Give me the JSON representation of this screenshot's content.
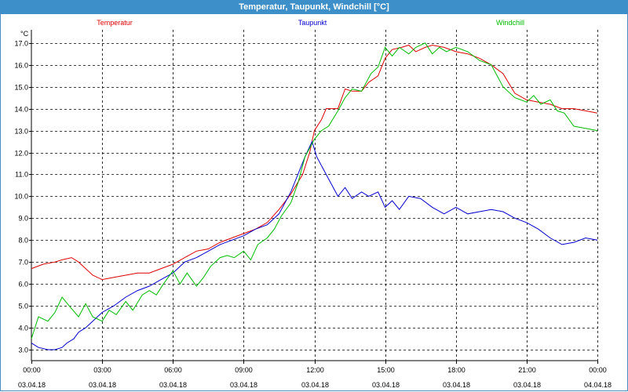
{
  "window": {
    "title": "Temperatur, Taupunkt, Windchill [°C]"
  },
  "chart_data": {
    "type": "line",
    "title": "Temperatur, Taupunkt, Windchill [°C]",
    "ylabel": "°C",
    "xlabel": "",
    "ylim": [
      2.5,
      17.6
    ],
    "xlim": [
      0,
      24
    ],
    "grid": true,
    "legend_placement": "top",
    "yticks": [
      3.0,
      4.0,
      5.0,
      6.0,
      7.0,
      8.0,
      9.0,
      10.0,
      11.0,
      12.0,
      13.0,
      14.0,
      15.0,
      16.0,
      17.0
    ],
    "xticks": [
      {
        "hour": 0,
        "time": "00:00",
        "date": "03.04.18"
      },
      {
        "hour": 3,
        "time": "03:00",
        "date": "03.04.18"
      },
      {
        "hour": 6,
        "time": "06:00",
        "date": "03.04.18"
      },
      {
        "hour": 9,
        "time": "09:00",
        "date": "03.04.18"
      },
      {
        "hour": 12,
        "time": "12:00",
        "date": "03.04.18"
      },
      {
        "hour": 15,
        "time": "15:00",
        "date": "03.04.18"
      },
      {
        "hour": 18,
        "time": "18:00",
        "date": "03.04.18"
      },
      {
        "hour": 21,
        "time": "21:00",
        "date": "03.04.18"
      },
      {
        "hour": 24,
        "time": "00:00",
        "date": "04.04.18"
      }
    ],
    "series": [
      {
        "name": "Temperatur",
        "color": "#dd0000",
        "points": [
          [
            0,
            6.7
          ],
          [
            0.5,
            6.9
          ],
          [
            1,
            7.0
          ],
          [
            1.3,
            7.1
          ],
          [
            1.7,
            7.2
          ],
          [
            2,
            7.0
          ],
          [
            2.3,
            6.7
          ],
          [
            2.6,
            6.4
          ],
          [
            3,
            6.2
          ],
          [
            3.5,
            6.3
          ],
          [
            4,
            6.4
          ],
          [
            4.5,
            6.5
          ],
          [
            5,
            6.5
          ],
          [
            5.5,
            6.7
          ],
          [
            6,
            6.9
          ],
          [
            6.5,
            7.2
          ],
          [
            7,
            7.5
          ],
          [
            7.5,
            7.6
          ],
          [
            8,
            7.9
          ],
          [
            8.5,
            8.1
          ],
          [
            9,
            8.3
          ],
          [
            9.5,
            8.5
          ],
          [
            10,
            8.8
          ],
          [
            10.5,
            9.4
          ],
          [
            11,
            10.1
          ],
          [
            11.5,
            11.0
          ],
          [
            11.8,
            12.0
          ],
          [
            12,
            13.0
          ],
          [
            12.3,
            13.5
          ],
          [
            12.5,
            14.0
          ],
          [
            13,
            14.0
          ],
          [
            13.3,
            14.9
          ],
          [
            13.6,
            14.8
          ],
          [
            14,
            14.8
          ],
          [
            14.3,
            15.2
          ],
          [
            14.7,
            15.5
          ],
          [
            15,
            16.3
          ],
          [
            15.3,
            16.7
          ],
          [
            15.7,
            16.8
          ],
          [
            16,
            16.9
          ],
          [
            16.3,
            16.6
          ],
          [
            16.7,
            16.8
          ],
          [
            17,
            16.9
          ],
          [
            17.5,
            16.8
          ],
          [
            18,
            16.6
          ],
          [
            18.5,
            16.5
          ],
          [
            19,
            16.3
          ],
          [
            19.5,
            16.0
          ],
          [
            20,
            15.6
          ],
          [
            20.5,
            14.7
          ],
          [
            21,
            14.4
          ],
          [
            21.5,
            14.3
          ],
          [
            22,
            14.2
          ],
          [
            22.5,
            14.0
          ],
          [
            23,
            14.0
          ],
          [
            23.5,
            13.9
          ],
          [
            24,
            13.8
          ]
        ]
      },
      {
        "name": "Taupunkt",
        "color": "#0000cc",
        "points": [
          [
            0,
            3.3
          ],
          [
            0.3,
            3.1
          ],
          [
            0.7,
            3.0
          ],
          [
            1,
            3.0
          ],
          [
            1.3,
            3.1
          ],
          [
            1.5,
            3.3
          ],
          [
            1.8,
            3.5
          ],
          [
            2,
            3.8
          ],
          [
            2.3,
            4.0
          ],
          [
            2.6,
            4.3
          ],
          [
            3,
            4.7
          ],
          [
            3.5,
            5.0
          ],
          [
            4,
            5.4
          ],
          [
            4.5,
            5.7
          ],
          [
            5,
            5.9
          ],
          [
            5.5,
            6.2
          ],
          [
            6,
            6.5
          ],
          [
            6.5,
            7.0
          ],
          [
            7,
            7.2
          ],
          [
            7.5,
            7.5
          ],
          [
            8,
            7.8
          ],
          [
            8.5,
            8.0
          ],
          [
            9,
            8.2
          ],
          [
            9.5,
            8.5
          ],
          [
            10,
            8.7
          ],
          [
            10.5,
            9.2
          ],
          [
            11,
            10.2
          ],
          [
            11.3,
            11.0
          ],
          [
            11.6,
            11.8
          ],
          [
            11.9,
            12.5
          ],
          [
            12.1,
            11.8
          ],
          [
            12.4,
            11.2
          ],
          [
            12.7,
            10.6
          ],
          [
            13,
            10.0
          ],
          [
            13.3,
            10.4
          ],
          [
            13.6,
            9.9
          ],
          [
            14,
            10.2
          ],
          [
            14.3,
            10.0
          ],
          [
            14.7,
            10.2
          ],
          [
            15,
            9.5
          ],
          [
            15.3,
            9.8
          ],
          [
            15.6,
            9.4
          ],
          [
            16,
            10.0
          ],
          [
            16.5,
            9.9
          ],
          [
            17,
            9.5
          ],
          [
            17.5,
            9.2
          ],
          [
            18,
            9.5
          ],
          [
            18.5,
            9.2
          ],
          [
            19,
            9.3
          ],
          [
            19.5,
            9.4
          ],
          [
            20,
            9.3
          ],
          [
            20.5,
            9.0
          ],
          [
            21,
            8.8
          ],
          [
            21.5,
            8.5
          ],
          [
            22,
            8.1
          ],
          [
            22.5,
            7.8
          ],
          [
            23,
            7.9
          ],
          [
            23.5,
            8.1
          ],
          [
            24,
            8.0
          ]
        ]
      },
      {
        "name": "Windchill",
        "color": "#00bb00",
        "points": [
          [
            0,
            3.5
          ],
          [
            0.3,
            4.5
          ],
          [
            0.7,
            4.3
          ],
          [
            1,
            4.7
          ],
          [
            1.3,
            5.4
          ],
          [
            1.6,
            5.0
          ],
          [
            2,
            4.5
          ],
          [
            2.3,
            5.1
          ],
          [
            2.6,
            4.5
          ],
          [
            3,
            4.3
          ],
          [
            3.3,
            4.8
          ],
          [
            3.6,
            4.6
          ],
          [
            4,
            5.2
          ],
          [
            4.3,
            4.8
          ],
          [
            4.7,
            5.5
          ],
          [
            5,
            5.7
          ],
          [
            5.3,
            5.5
          ],
          [
            5.6,
            6.0
          ],
          [
            6,
            6.6
          ],
          [
            6.3,
            6.0
          ],
          [
            6.6,
            6.5
          ],
          [
            7,
            5.9
          ],
          [
            7.3,
            6.3
          ],
          [
            7.6,
            6.8
          ],
          [
            8,
            7.2
          ],
          [
            8.3,
            7.3
          ],
          [
            8.6,
            7.2
          ],
          [
            9,
            7.5
          ],
          [
            9.3,
            7.1
          ],
          [
            9.6,
            7.8
          ],
          [
            10,
            8.1
          ],
          [
            10.3,
            8.5
          ],
          [
            10.6,
            9.1
          ],
          [
            11,
            9.7
          ],
          [
            11.3,
            10.6
          ],
          [
            11.6,
            11.8
          ],
          [
            12,
            12.6
          ],
          [
            12.3,
            13.0
          ],
          [
            12.6,
            13.2
          ],
          [
            13,
            13.9
          ],
          [
            13.3,
            14.5
          ],
          [
            13.6,
            14.9
          ],
          [
            14,
            14.8
          ],
          [
            14.4,
            15.6
          ],
          [
            14.7,
            15.9
          ],
          [
            15,
            16.8
          ],
          [
            15.3,
            16.4
          ],
          [
            15.6,
            16.8
          ],
          [
            16,
            16.5
          ],
          [
            16.3,
            16.8
          ],
          [
            16.7,
            17.0
          ],
          [
            17,
            16.5
          ],
          [
            17.3,
            16.8
          ],
          [
            17.6,
            16.6
          ],
          [
            18,
            16.8
          ],
          [
            18.5,
            16.6
          ],
          [
            19,
            16.2
          ],
          [
            19.5,
            16.0
          ],
          [
            20,
            15.0
          ],
          [
            20.5,
            14.5
          ],
          [
            21,
            14.3
          ],
          [
            21.3,
            14.6
          ],
          [
            21.6,
            14.2
          ],
          [
            22,
            14.4
          ],
          [
            22.3,
            13.9
          ],
          [
            22.6,
            13.8
          ],
          [
            23,
            13.2
          ],
          [
            23.5,
            13.1
          ],
          [
            24,
            13.0
          ]
        ]
      }
    ]
  }
}
